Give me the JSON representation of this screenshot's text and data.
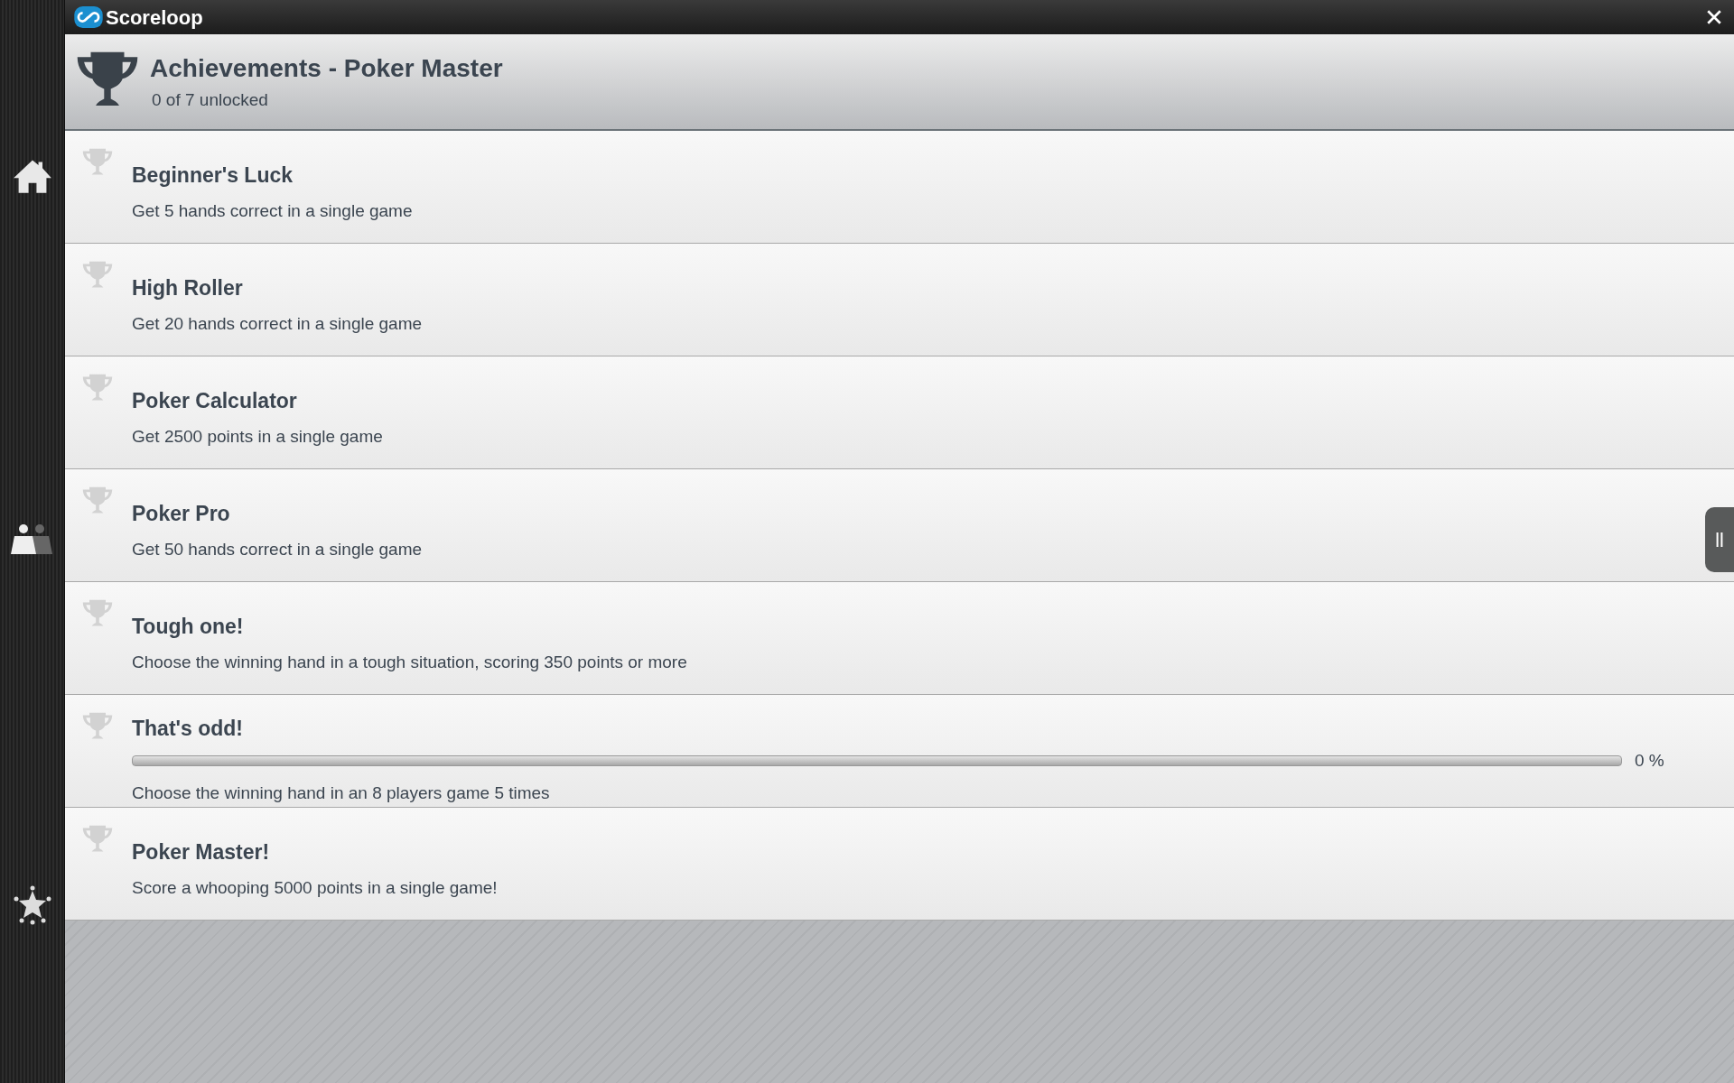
{
  "window": {
    "title": "Scoreloop"
  },
  "header": {
    "title": "Achievements - Poker Master",
    "subtitle": "0 of 7 unlocked"
  },
  "achievements": [
    {
      "kind": "plain",
      "name": "Beginner's Luck",
      "description": "Get 5 hands correct in a single game"
    },
    {
      "kind": "plain",
      "name": "High Roller",
      "description": "Get 20 hands correct in a single game"
    },
    {
      "kind": "plain",
      "name": "Poker Calculator",
      "description": "Get 2500 points in a single game"
    },
    {
      "kind": "plain",
      "name": "Poker Pro",
      "description": "Get 50 hands correct in a single game"
    },
    {
      "kind": "plain",
      "name": "Tough one!",
      "description": "Choose the winning hand in a tough situation, scoring 350 points or more"
    },
    {
      "kind": "progress",
      "name": "That's odd!",
      "level": 0,
      "reading": "0 %",
      "description": "Choose the winning hand in an 8 players game 5 times"
    },
    {
      "kind": "plain",
      "name": "Poker Master!",
      "description": "Score a whooping 5000 points in a single game!"
    }
  ]
}
